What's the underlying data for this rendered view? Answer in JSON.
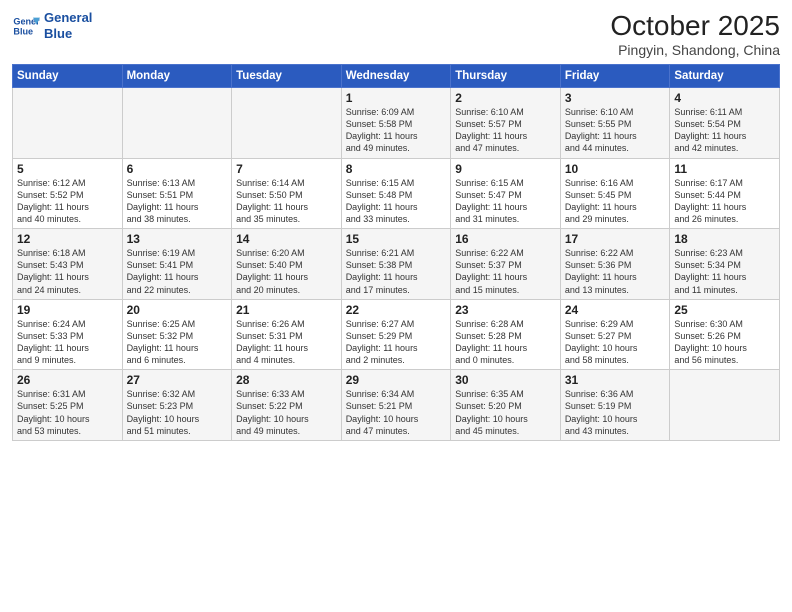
{
  "header": {
    "logo_line1": "General",
    "logo_line2": "Blue",
    "month": "October 2025",
    "location": "Pingyin, Shandong, China"
  },
  "weekdays": [
    "Sunday",
    "Monday",
    "Tuesday",
    "Wednesday",
    "Thursday",
    "Friday",
    "Saturday"
  ],
  "weeks": [
    [
      {
        "day": "",
        "info": ""
      },
      {
        "day": "",
        "info": ""
      },
      {
        "day": "",
        "info": ""
      },
      {
        "day": "1",
        "info": "Sunrise: 6:09 AM\nSunset: 5:58 PM\nDaylight: 11 hours\nand 49 minutes."
      },
      {
        "day": "2",
        "info": "Sunrise: 6:10 AM\nSunset: 5:57 PM\nDaylight: 11 hours\nand 47 minutes."
      },
      {
        "day": "3",
        "info": "Sunrise: 6:10 AM\nSunset: 5:55 PM\nDaylight: 11 hours\nand 44 minutes."
      },
      {
        "day": "4",
        "info": "Sunrise: 6:11 AM\nSunset: 5:54 PM\nDaylight: 11 hours\nand 42 minutes."
      }
    ],
    [
      {
        "day": "5",
        "info": "Sunrise: 6:12 AM\nSunset: 5:52 PM\nDaylight: 11 hours\nand 40 minutes."
      },
      {
        "day": "6",
        "info": "Sunrise: 6:13 AM\nSunset: 5:51 PM\nDaylight: 11 hours\nand 38 minutes."
      },
      {
        "day": "7",
        "info": "Sunrise: 6:14 AM\nSunset: 5:50 PM\nDaylight: 11 hours\nand 35 minutes."
      },
      {
        "day": "8",
        "info": "Sunrise: 6:15 AM\nSunset: 5:48 PM\nDaylight: 11 hours\nand 33 minutes."
      },
      {
        "day": "9",
        "info": "Sunrise: 6:15 AM\nSunset: 5:47 PM\nDaylight: 11 hours\nand 31 minutes."
      },
      {
        "day": "10",
        "info": "Sunrise: 6:16 AM\nSunset: 5:45 PM\nDaylight: 11 hours\nand 29 minutes."
      },
      {
        "day": "11",
        "info": "Sunrise: 6:17 AM\nSunset: 5:44 PM\nDaylight: 11 hours\nand 26 minutes."
      }
    ],
    [
      {
        "day": "12",
        "info": "Sunrise: 6:18 AM\nSunset: 5:43 PM\nDaylight: 11 hours\nand 24 minutes."
      },
      {
        "day": "13",
        "info": "Sunrise: 6:19 AM\nSunset: 5:41 PM\nDaylight: 11 hours\nand 22 minutes."
      },
      {
        "day": "14",
        "info": "Sunrise: 6:20 AM\nSunset: 5:40 PM\nDaylight: 11 hours\nand 20 minutes."
      },
      {
        "day": "15",
        "info": "Sunrise: 6:21 AM\nSunset: 5:38 PM\nDaylight: 11 hours\nand 17 minutes."
      },
      {
        "day": "16",
        "info": "Sunrise: 6:22 AM\nSunset: 5:37 PM\nDaylight: 11 hours\nand 15 minutes."
      },
      {
        "day": "17",
        "info": "Sunrise: 6:22 AM\nSunset: 5:36 PM\nDaylight: 11 hours\nand 13 minutes."
      },
      {
        "day": "18",
        "info": "Sunrise: 6:23 AM\nSunset: 5:34 PM\nDaylight: 11 hours\nand 11 minutes."
      }
    ],
    [
      {
        "day": "19",
        "info": "Sunrise: 6:24 AM\nSunset: 5:33 PM\nDaylight: 11 hours\nand 9 minutes."
      },
      {
        "day": "20",
        "info": "Sunrise: 6:25 AM\nSunset: 5:32 PM\nDaylight: 11 hours\nand 6 minutes."
      },
      {
        "day": "21",
        "info": "Sunrise: 6:26 AM\nSunset: 5:31 PM\nDaylight: 11 hours\nand 4 minutes."
      },
      {
        "day": "22",
        "info": "Sunrise: 6:27 AM\nSunset: 5:29 PM\nDaylight: 11 hours\nand 2 minutes."
      },
      {
        "day": "23",
        "info": "Sunrise: 6:28 AM\nSunset: 5:28 PM\nDaylight: 11 hours\nand 0 minutes."
      },
      {
        "day": "24",
        "info": "Sunrise: 6:29 AM\nSunset: 5:27 PM\nDaylight: 10 hours\nand 58 minutes."
      },
      {
        "day": "25",
        "info": "Sunrise: 6:30 AM\nSunset: 5:26 PM\nDaylight: 10 hours\nand 56 minutes."
      }
    ],
    [
      {
        "day": "26",
        "info": "Sunrise: 6:31 AM\nSunset: 5:25 PM\nDaylight: 10 hours\nand 53 minutes."
      },
      {
        "day": "27",
        "info": "Sunrise: 6:32 AM\nSunset: 5:23 PM\nDaylight: 10 hours\nand 51 minutes."
      },
      {
        "day": "28",
        "info": "Sunrise: 6:33 AM\nSunset: 5:22 PM\nDaylight: 10 hours\nand 49 minutes."
      },
      {
        "day": "29",
        "info": "Sunrise: 6:34 AM\nSunset: 5:21 PM\nDaylight: 10 hours\nand 47 minutes."
      },
      {
        "day": "30",
        "info": "Sunrise: 6:35 AM\nSunset: 5:20 PM\nDaylight: 10 hours\nand 45 minutes."
      },
      {
        "day": "31",
        "info": "Sunrise: 6:36 AM\nSunset: 5:19 PM\nDaylight: 10 hours\nand 43 minutes."
      },
      {
        "day": "",
        "info": ""
      }
    ]
  ]
}
